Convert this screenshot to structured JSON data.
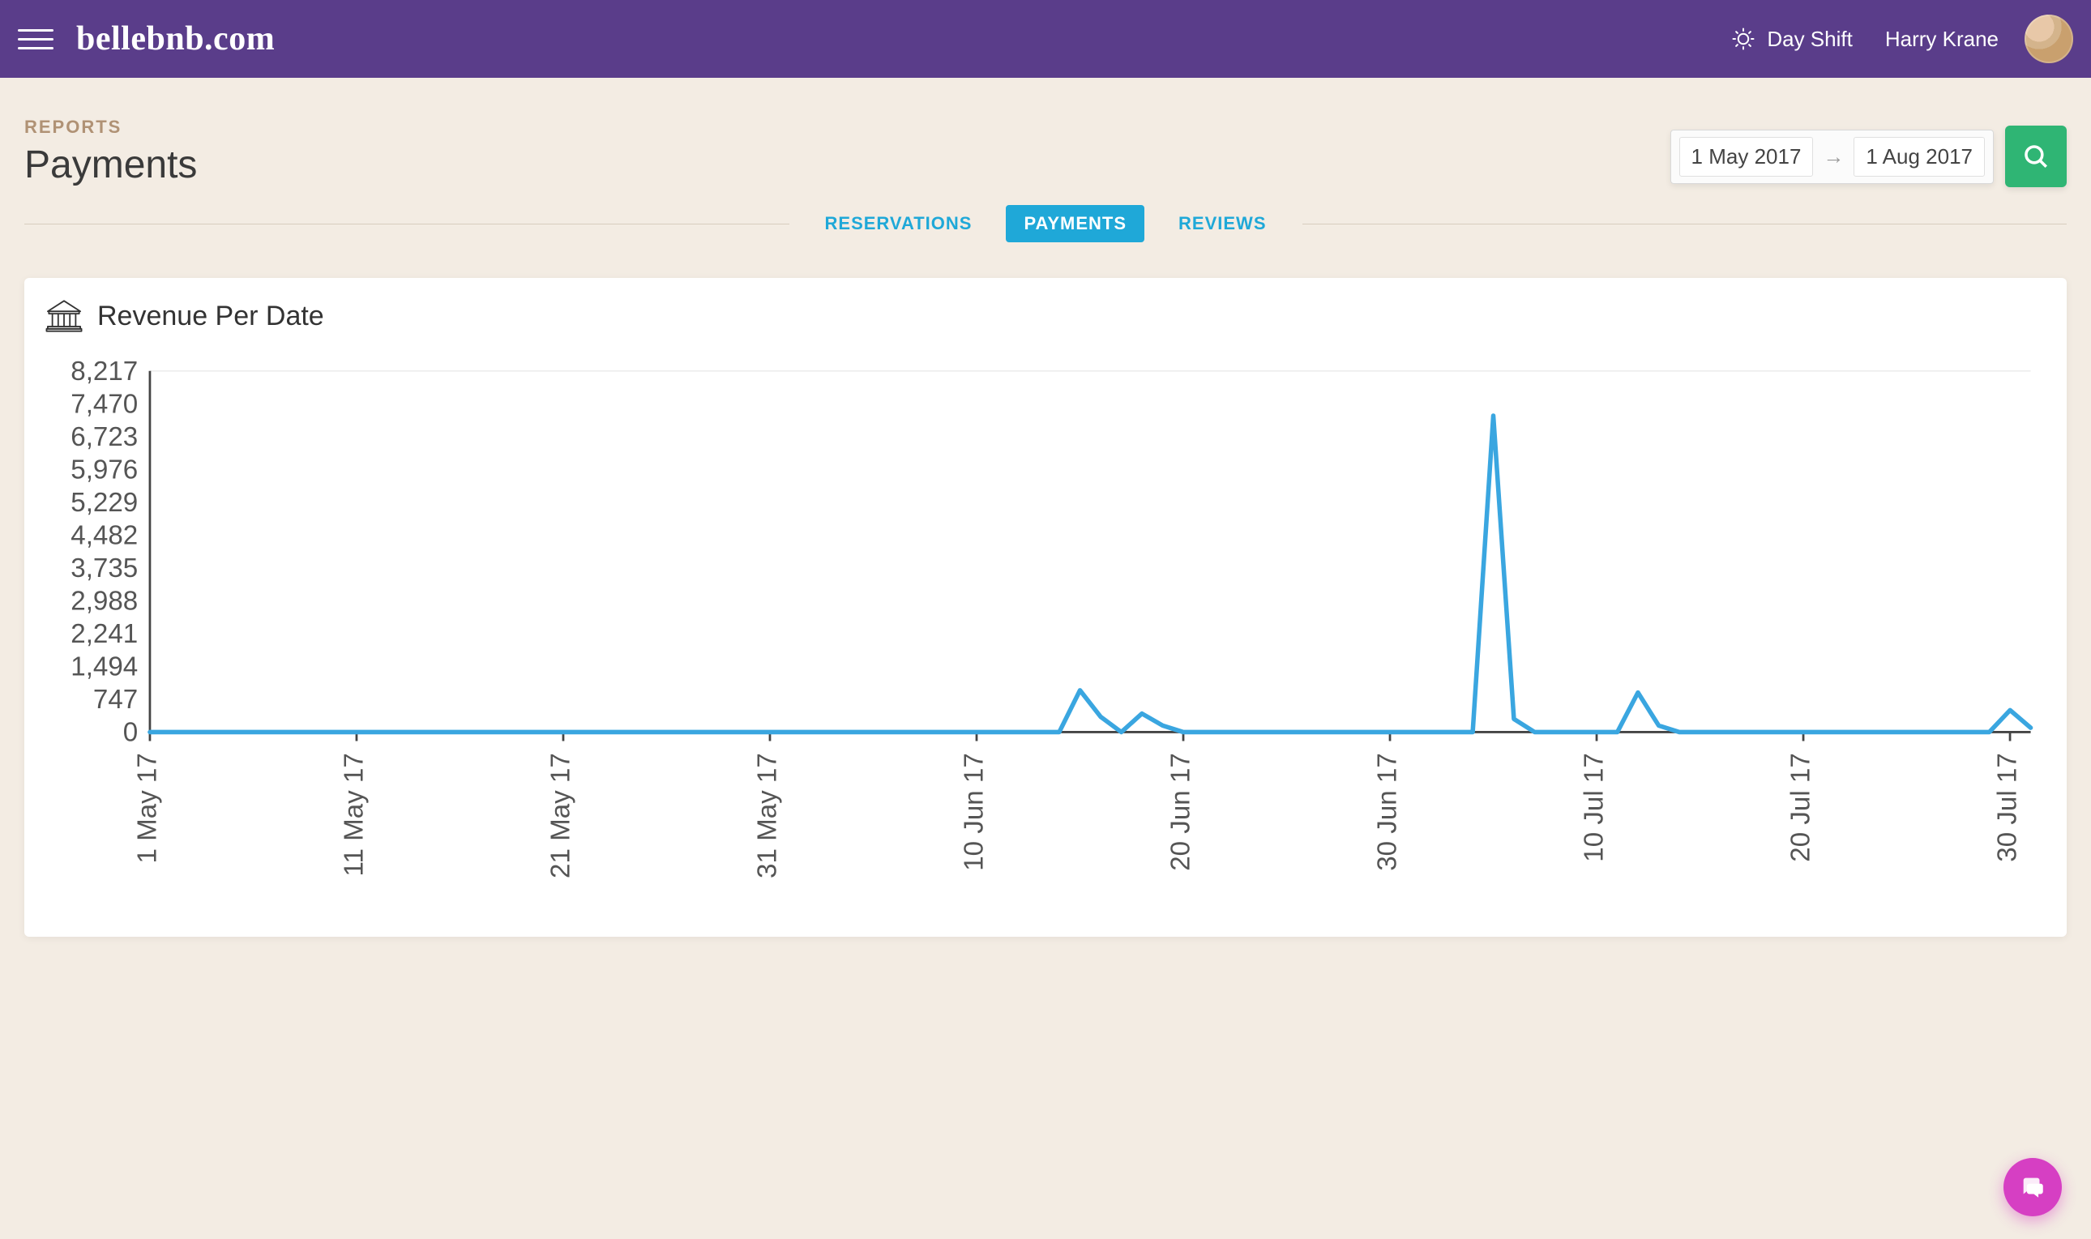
{
  "header": {
    "brand": "bellebnb.com",
    "shift_label": "Day Shift",
    "user_name": "Harry Krane"
  },
  "page": {
    "section_label": "REPORTS",
    "title": "Payments"
  },
  "date_range": {
    "from": "1 May 2017",
    "to": "1 Aug 2017"
  },
  "tabs": [
    {
      "label": "RESERVATIONS",
      "active": false
    },
    {
      "label": "PAYMENTS",
      "active": true
    },
    {
      "label": "REVIEWS",
      "active": false
    }
  ],
  "card": {
    "title": "Revenue Per Date"
  },
  "chart_data": {
    "type": "line",
    "title": "Revenue Per Date",
    "xlabel": "",
    "ylabel": "",
    "ylim": [
      0,
      8217
    ],
    "y_ticks": [
      0,
      747,
      1494,
      2241,
      2988,
      3735,
      4482,
      5229,
      5976,
      6723,
      7470,
      8217
    ],
    "y_tick_labels": [
      "0",
      "747",
      "1,494",
      "2,241",
      "2,988",
      "3,735",
      "4,482",
      "5,229",
      "5,976",
      "6,723",
      "7,470",
      "8,217"
    ],
    "x_tick_indices": [
      0,
      10,
      20,
      30,
      40,
      50,
      60,
      70,
      80,
      90
    ],
    "x_tick_labels": [
      "1 May 17",
      "11 May 17",
      "21 May 17",
      "31 May 17",
      "10 Jun 17",
      "20 Jun 17",
      "30 Jun 17",
      "10 Jul 17",
      "20 Jul 17",
      "30 Jul 17"
    ],
    "series": [
      {
        "name": "Revenue",
        "color": "#3aa6e0",
        "x": [
          0,
          1,
          2,
          3,
          4,
          5,
          6,
          7,
          8,
          9,
          10,
          11,
          12,
          13,
          14,
          15,
          16,
          17,
          18,
          19,
          20,
          21,
          22,
          23,
          24,
          25,
          26,
          27,
          28,
          29,
          30,
          31,
          32,
          33,
          34,
          35,
          36,
          37,
          38,
          39,
          40,
          41,
          42,
          43,
          44,
          45,
          46,
          47,
          48,
          49,
          50,
          51,
          52,
          53,
          54,
          55,
          56,
          57,
          58,
          59,
          60,
          61,
          62,
          63,
          64,
          65,
          66,
          67,
          68,
          69,
          70,
          71,
          72,
          73,
          74,
          75,
          76,
          77,
          78,
          79,
          80,
          81,
          82,
          83,
          84,
          85,
          86,
          87,
          88,
          89,
          90,
          91
        ],
        "values": [
          0,
          0,
          0,
          0,
          0,
          0,
          0,
          0,
          0,
          0,
          0,
          0,
          0,
          0,
          0,
          0,
          0,
          0,
          0,
          0,
          0,
          0,
          0,
          0,
          0,
          0,
          0,
          0,
          0,
          0,
          0,
          0,
          0,
          0,
          0,
          0,
          0,
          0,
          0,
          0,
          0,
          0,
          0,
          0,
          0,
          950,
          350,
          0,
          420,
          150,
          0,
          0,
          0,
          0,
          0,
          0,
          0,
          0,
          0,
          0,
          0,
          0,
          0,
          0,
          0,
          7200,
          300,
          0,
          0,
          0,
          0,
          0,
          900,
          150,
          0,
          0,
          0,
          0,
          0,
          0,
          0,
          0,
          0,
          0,
          0,
          0,
          0,
          0,
          0,
          0,
          500,
          100
        ]
      }
    ]
  },
  "colors": {
    "header_bg": "#5a3d8a",
    "body_bg": "#f3ece3",
    "accent_blue": "#1fa8d8",
    "accent_green": "#2fb574",
    "accent_pink": "#d63fc3",
    "line": "#3aa6e0"
  }
}
